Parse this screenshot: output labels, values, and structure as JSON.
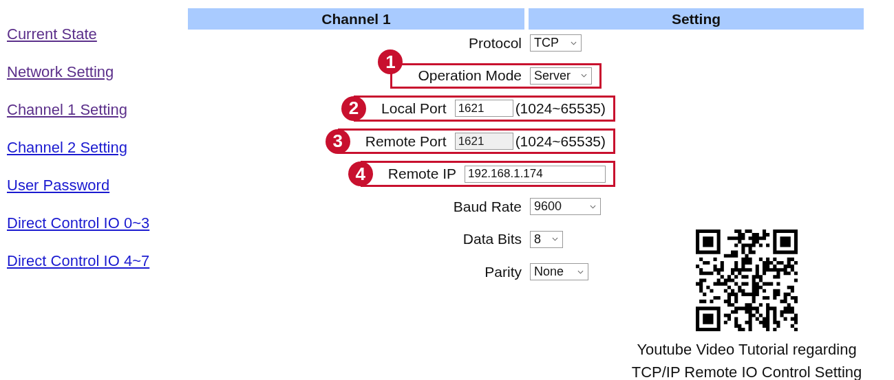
{
  "nav": [
    {
      "label": "Current State",
      "visited": true
    },
    {
      "label": "Network Setting",
      "visited": true
    },
    {
      "label": "Channel 1 Setting",
      "visited": true
    },
    {
      "label": "Channel 2 Setting",
      "visited": false
    },
    {
      "label": "User Password",
      "visited": false
    },
    {
      "label": "Direct Control IO 0~3",
      "visited": false
    },
    {
      "label": "Direct Control IO 4~7",
      "visited": false
    }
  ],
  "header": {
    "column_1": "Channel 1",
    "column_2": "Setting"
  },
  "rows": [
    {
      "label": "Protocol",
      "kind": "select",
      "value": "TCP"
    },
    {
      "label": "Operation Mode",
      "kind": "select",
      "value": "Server",
      "callout": "1"
    },
    {
      "label": "Local Port",
      "kind": "text",
      "value": "1621",
      "disabled": false,
      "hint": "(1024~65535)",
      "callout": "2"
    },
    {
      "label": "Remote Port",
      "kind": "text",
      "value": "1621",
      "disabled": true,
      "hint": "(1024~65535)",
      "callout": "3"
    },
    {
      "label": "Remote IP",
      "kind": "text",
      "value": "192.168.1.174",
      "disabled": false,
      "callout": "4"
    },
    {
      "label": "Baud Rate",
      "kind": "select",
      "value": "9600"
    },
    {
      "label": "Data Bits",
      "kind": "select",
      "value": "8"
    },
    {
      "label": "Parity",
      "kind": "select",
      "value": "None"
    }
  ],
  "qr": {
    "caption_lines": [
      "Youtube Video Tutorial regarding",
      "TCP/IP Remote IO Control Setting"
    ]
  }
}
